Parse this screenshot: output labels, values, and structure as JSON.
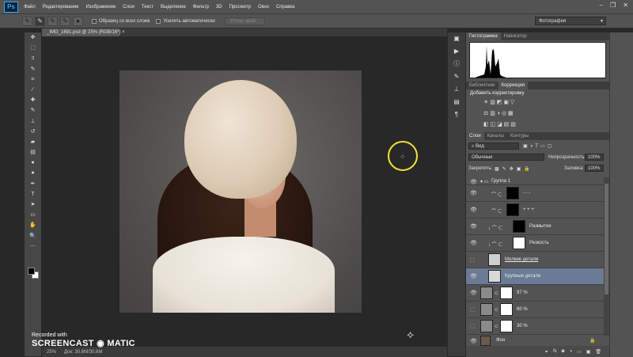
{
  "app": {
    "logo": "Ps",
    "window_controls": [
      "–",
      "❐",
      "✕"
    ]
  },
  "menu": [
    "Файл",
    "Редактирование",
    "Изображение",
    "Слои",
    "Текст",
    "Выделение",
    "Фильтр",
    "3D",
    "Просмотр",
    "Окно",
    "Справка"
  ],
  "options_bar": {
    "sample_all_layers": "Образец со всех слоев",
    "auto_enhance": "Усилить автоматически",
    "refine_edge": "Уточн. край...",
    "workspace": "Фотография"
  },
  "document": {
    "tab_title": "_IMG_1691.psd @ 25% (RGB/16*)",
    "close": "×"
  },
  "status_bar": {
    "zoom": "25%",
    "doc_size": "Док: 30,6M/30,6M"
  },
  "watermark": {
    "line1": "Recorded with",
    "brand": "SCREENCAST ◉ MATIC"
  },
  "panels": {
    "histogram_tabs": [
      "Гистограмма",
      "Навигатор"
    ],
    "adjust_tabs": [
      "Библиотеки",
      "Коррекция"
    ],
    "adjust_title": "Добавить корректировку",
    "adjust_row1": "☀ ▥ ◩ ▣ ▽",
    "adjust_row2": "⚖ ▥ ◑ ◎ ▦",
    "adjust_row3": "◧ ◫ ◪ ▤ ▧",
    "layers_tabs": [
      "Слои",
      "Каналы",
      "Контуры"
    ],
    "filter_kind": "Вид",
    "blend_mode": "Обычные",
    "opacity_label": "Непрозрачность:",
    "opacity_value": "100%",
    "lock_label": "Закрепить:",
    "fill_label": "Заливка:",
    "fill_value": "100%"
  },
  "layers": [
    {
      "name": "Группа 1",
      "type": "group",
      "visible": true
    },
    {
      "name": "- - -",
      "type": "adjustment",
      "visible": true
    },
    {
      "name": "+ + +",
      "type": "adjustment",
      "visible": true
    },
    {
      "name": "Размытие",
      "type": "adjustment",
      "visible": true
    },
    {
      "name": "Резкость",
      "type": "adjustment",
      "visible": true
    },
    {
      "name": "Мелкие детали",
      "type": "layer",
      "visible": false
    },
    {
      "name": "Крупные детали",
      "type": "layer",
      "visible": true,
      "selected": true
    },
    {
      "name": "97 %",
      "type": "layer",
      "visible": true
    },
    {
      "name": "60 %",
      "type": "layer",
      "visible": false
    },
    {
      "name": "30 %",
      "type": "layer",
      "visible": false
    },
    {
      "name": "Фон",
      "type": "background",
      "visible": true
    }
  ],
  "colors": {
    "accent_selected": "#6a7b96",
    "cursor_ring": "#f0e33a"
  }
}
